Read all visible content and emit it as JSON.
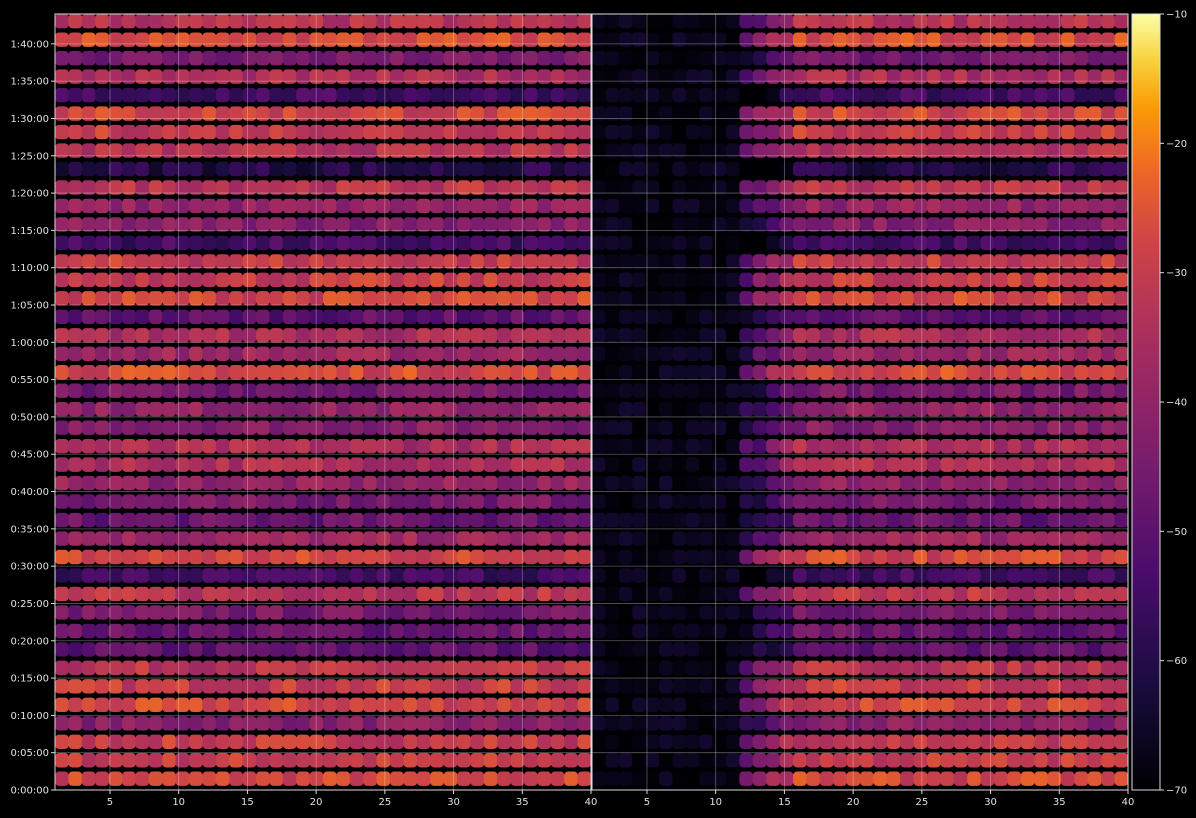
{
  "chart_data": {
    "type": "heatmap",
    "title": "",
    "xlabel": "",
    "ylabel": "",
    "panels": [
      {
        "name": "",
        "x_range": [
          1,
          40
        ],
        "x_ticks": [
          "5",
          "10",
          "15",
          "20",
          "25",
          "30",
          "35",
          "40"
        ],
        "x_tick_values": [
          5,
          10,
          15,
          20,
          25,
          30,
          35,
          40
        ]
      },
      {
        "name": "",
        "x_range": [
          1,
          40
        ],
        "x_ticks": [
          "5",
          "10",
          "15",
          "20",
          "25",
          "30",
          "35",
          "40"
        ],
        "x_tick_values": [
          5,
          10,
          15,
          20,
          25,
          30,
          35,
          40
        ]
      }
    ],
    "y_range_seconds": [
      0,
      6240
    ],
    "y_ticks": [
      "0:00:00",
      "0:05:00",
      "0:10:00",
      "0:15:00",
      "0:20:00",
      "0:25:00",
      "0:30:00",
      "0:35:00",
      "0:40:00",
      "0:45:00",
      "0:50:00",
      "0:55:00",
      "1:00:00",
      "1:05:00",
      "1:10:00",
      "1:15:00",
      "1:20:00",
      "1:25:00",
      "1:30:00",
      "1:35:00",
      "1:40:00"
    ],
    "y_tick_values_seconds": [
      0,
      300,
      600,
      900,
      1200,
      1500,
      1800,
      2100,
      2400,
      2700,
      3000,
      3300,
      3600,
      3900,
      4200,
      4500,
      4800,
      5100,
      5400,
      5700,
      6000
    ],
    "colorbar": {
      "colormap": "inferno",
      "range": [
        -70,
        -10
      ],
      "ticks": [
        "−70",
        "−60",
        "−50",
        "−40",
        "−30",
        "−20",
        "−10"
      ],
      "tick_values": [
        -70,
        -60,
        -50,
        -40,
        -30,
        -20,
        -10
      ]
    },
    "grid": true,
    "row_levels_approx": [
      {
        "t": 30,
        "v": -28
      },
      {
        "t": 150,
        "v": -30
      },
      {
        "t": 300,
        "v": -30
      },
      {
        "t": 450,
        "v": -42
      },
      {
        "t": 600,
        "v": -28
      },
      {
        "t": 750,
        "v": -30
      },
      {
        "t": 900,
        "v": -32
      },
      {
        "t": 1050,
        "v": -50
      },
      {
        "t": 1200,
        "v": -48
      },
      {
        "t": 1350,
        "v": -45
      },
      {
        "t": 1500,
        "v": -32
      },
      {
        "t": 1650,
        "v": -55
      },
      {
        "t": 1800,
        "v": -28
      },
      {
        "t": 1950,
        "v": -38
      },
      {
        "t": 2100,
        "v": -48
      },
      {
        "t": 2250,
        "v": -45
      },
      {
        "t": 2400,
        "v": -40
      },
      {
        "t": 2550,
        "v": -34
      },
      {
        "t": 2700,
        "v": -35
      },
      {
        "t": 2850,
        "v": -42
      },
      {
        "t": 3000,
        "v": -40
      },
      {
        "t": 3150,
        "v": -45
      },
      {
        "t": 3300,
        "v": -27
      },
      {
        "t": 3450,
        "v": -38
      },
      {
        "t": 3600,
        "v": -35
      },
      {
        "t": 3750,
        "v": -50
      },
      {
        "t": 3900,
        "v": -28
      },
      {
        "t": 4050,
        "v": -30
      },
      {
        "t": 4200,
        "v": -30
      },
      {
        "t": 4350,
        "v": -55
      },
      {
        "t": 4500,
        "v": -42
      },
      {
        "t": 4650,
        "v": -40
      },
      {
        "t": 4800,
        "v": -32
      },
      {
        "t": 4950,
        "v": -60
      },
      {
        "t": 5100,
        "v": -33
      },
      {
        "t": 5250,
        "v": -30
      },
      {
        "t": 5400,
        "v": -28
      },
      {
        "t": 5550,
        "v": -55
      },
      {
        "t": 5700,
        "v": -35
      },
      {
        "t": 5850,
        "v": -45
      },
      {
        "t": 6000,
        "v": -27
      },
      {
        "t": 6150,
        "v": -33
      }
    ]
  }
}
